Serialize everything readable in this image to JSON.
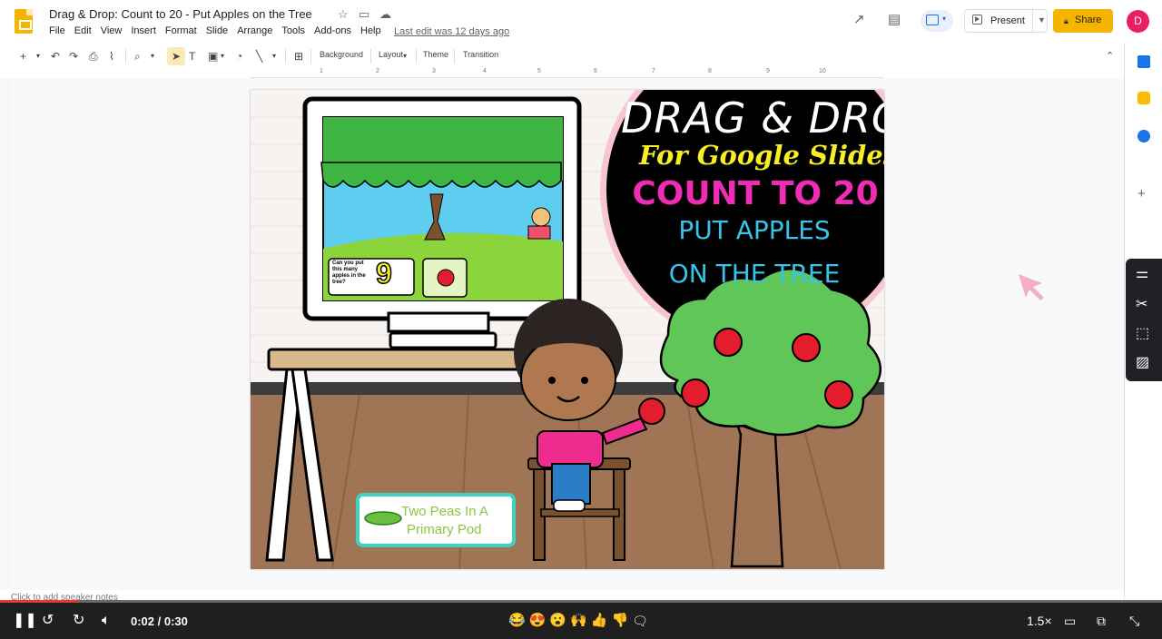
{
  "document": {
    "title": "Drag & Drop: Count to 20 - Put Apples on the Tree",
    "last_edit": "Last edit was 12 days ago"
  },
  "menu": [
    "File",
    "Edit",
    "View",
    "Insert",
    "Format",
    "Slide",
    "Arrange",
    "Tools",
    "Add-ons",
    "Help"
  ],
  "header": {
    "present_label": "Present",
    "share_label": "Share",
    "avatar_letter": "D"
  },
  "toolbar": {
    "background_label": "Background",
    "layout_label": "Layout",
    "theme_label": "Theme",
    "transition_label": "Transition"
  },
  "ruler": [
    "1",
    "2",
    "3",
    "4",
    "5",
    "6",
    "7",
    "8",
    "9",
    "10"
  ],
  "slide": {
    "title_line1": "DRAG & DROP",
    "title_line2": "For Google Slides",
    "title_line3": "COUNT TO 20",
    "title_line4": "PUT APPLES",
    "title_line5": "ON THE TREE",
    "monitor_prompt": "Can you put this many apples in the tree?",
    "monitor_number": "9",
    "brand_line1": "Two Peas In A",
    "brand_line2": "Primary Pod"
  },
  "speaker_notes_placeholder": "Click to add speaker notes",
  "player": {
    "time_display": "0:02 / 0:30",
    "speed": "1.5×",
    "progress_fraction": 0.067,
    "reactions": [
      "😂",
      "😍",
      "😮",
      "🙌",
      "👍",
      "👎"
    ]
  },
  "colors": {
    "slides_yellow": "#f4b400",
    "avatar_pink": "#e91e63",
    "slide_title_white": "#ffffff",
    "slide_subtitle_yellow": "#f7ef24",
    "slide_count_pink": "#ee2cb4",
    "slide_apples_blue": "#36c4ea",
    "progress_red": "#e53935"
  }
}
